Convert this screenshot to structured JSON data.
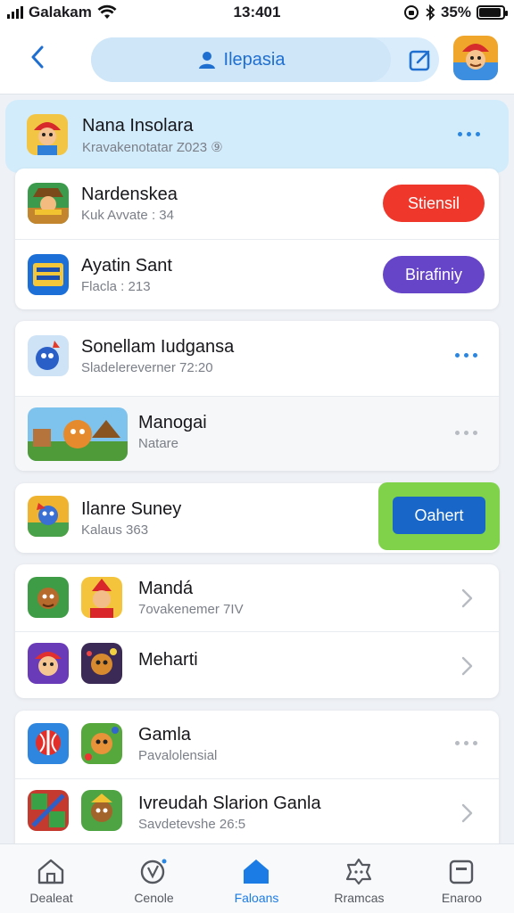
{
  "status_bar": {
    "carrier": "Galakam",
    "time": "13:401",
    "battery": "35%",
    "battery_level": 0.92
  },
  "header": {
    "search_label": "Ilepasia",
    "back_icon": "chevron-left-icon",
    "edit_icon": "edit-icon",
    "accent": "#1f6fd1"
  },
  "list": {
    "highlighted": {
      "title": "Nana Insolara",
      "subtitle": "Kravakenotatar Z023 ⑨"
    },
    "card1": [
      {
        "title": "Nardenskea",
        "subtitle": "Kuk Avvate : 34",
        "button": "Stiensil"
      },
      {
        "title": "Ayatin Sant",
        "subtitle": "Flacla : 213",
        "button": "Birafiniy"
      }
    ],
    "card2": [
      {
        "title": "Sonellam Iudgansa",
        "subtitle": "Sladelereverner 72:20"
      },
      {
        "title": "Manogai",
        "subtitle": "Natare"
      }
    ],
    "card3": {
      "title": "Ilanre Suney",
      "subtitle": "Kalaus 363",
      "button": "Oahert"
    },
    "card4": [
      {
        "title": "Mandá",
        "subtitle": "7ovakenemer 7IV"
      },
      {
        "title": "Meharti",
        "subtitle": ""
      }
    ],
    "card5": [
      {
        "title": "Gamla",
        "subtitle": "Pavalolensial"
      },
      {
        "title": "Ivreudah Slarion Ganla",
        "subtitle": "Savdetevshe 26:5"
      }
    ]
  },
  "colors": {
    "red_button": "#f0372b",
    "purple_button": "#6645c9",
    "blue_button": "#1867c8",
    "green_frame": "#7fd24a",
    "dots_blue": "#2a86e0",
    "dots_gray": "#b7bbc2"
  },
  "bottom_nav": [
    {
      "label": "Dealeat",
      "icon": "home-icon"
    },
    {
      "label": "Cenole",
      "icon": "compass-icon"
    },
    {
      "label": "Faloans",
      "icon": "house-filled-icon"
    },
    {
      "label": "Rramcas",
      "icon": "badge-icon"
    },
    {
      "label": "Enaroo",
      "icon": "wallet-icon"
    }
  ]
}
